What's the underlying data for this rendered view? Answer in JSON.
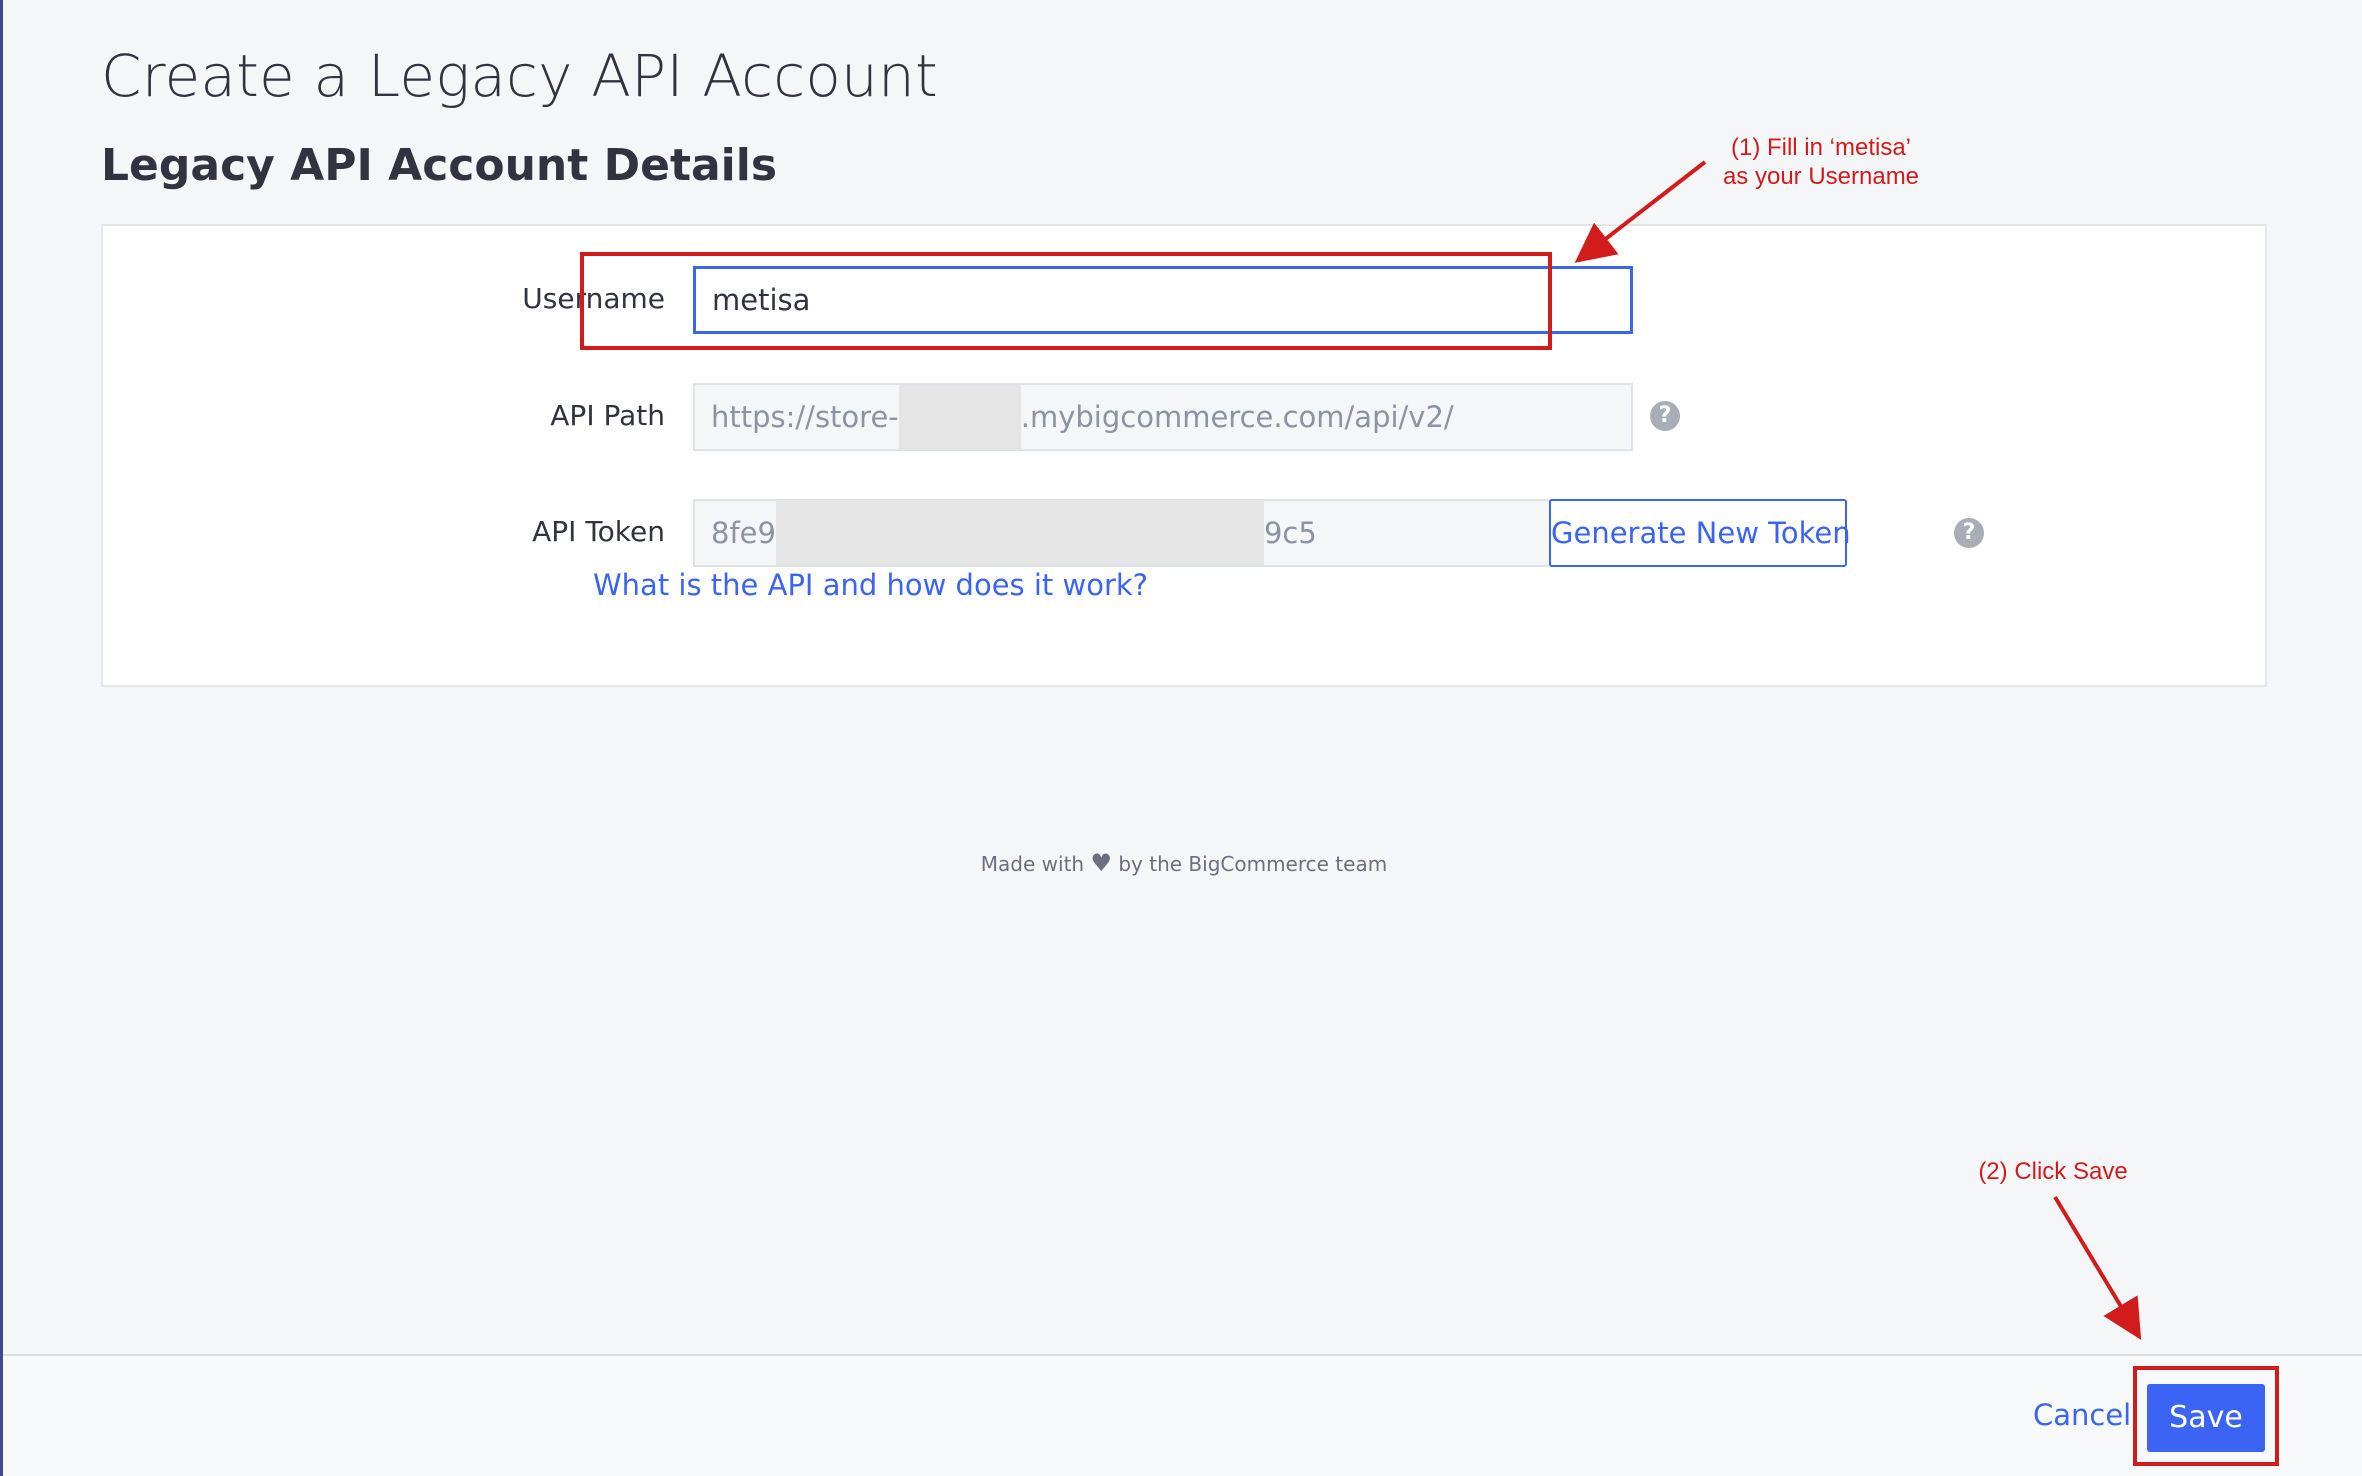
{
  "page": {
    "title": "Create a Legacy API Account",
    "section_title": "Legacy API Account Details"
  },
  "form": {
    "username": {
      "label": "Username",
      "value": "metisa"
    },
    "api_path": {
      "label": "API Path",
      "value_prefix": "https://store-",
      "value_suffix": ".mybigcommerce.com/api/v2/"
    },
    "api_token": {
      "label": "API Token",
      "value_prefix": "8fe9",
      "value_suffix": "9c5",
      "generate_button": "Generate New Token",
      "help_link": "What is the API and how does it work?"
    },
    "help_icon_glyph": "?"
  },
  "footer": {
    "made_with": "Made with",
    "by_team": "by the BigCommerce team",
    "heart_icon": "heart-icon"
  },
  "actions": {
    "cancel_label": "Cancel",
    "save_label": "Save"
  },
  "annotations": {
    "step1_line1": "(1) Fill in ‘metisa’",
    "step1_line2": "as your Username",
    "step2": "(2) Click Save"
  },
  "colors": {
    "accent": "#3c64f4",
    "annotation": "#d21c1c",
    "background": "#f5f6f8"
  }
}
